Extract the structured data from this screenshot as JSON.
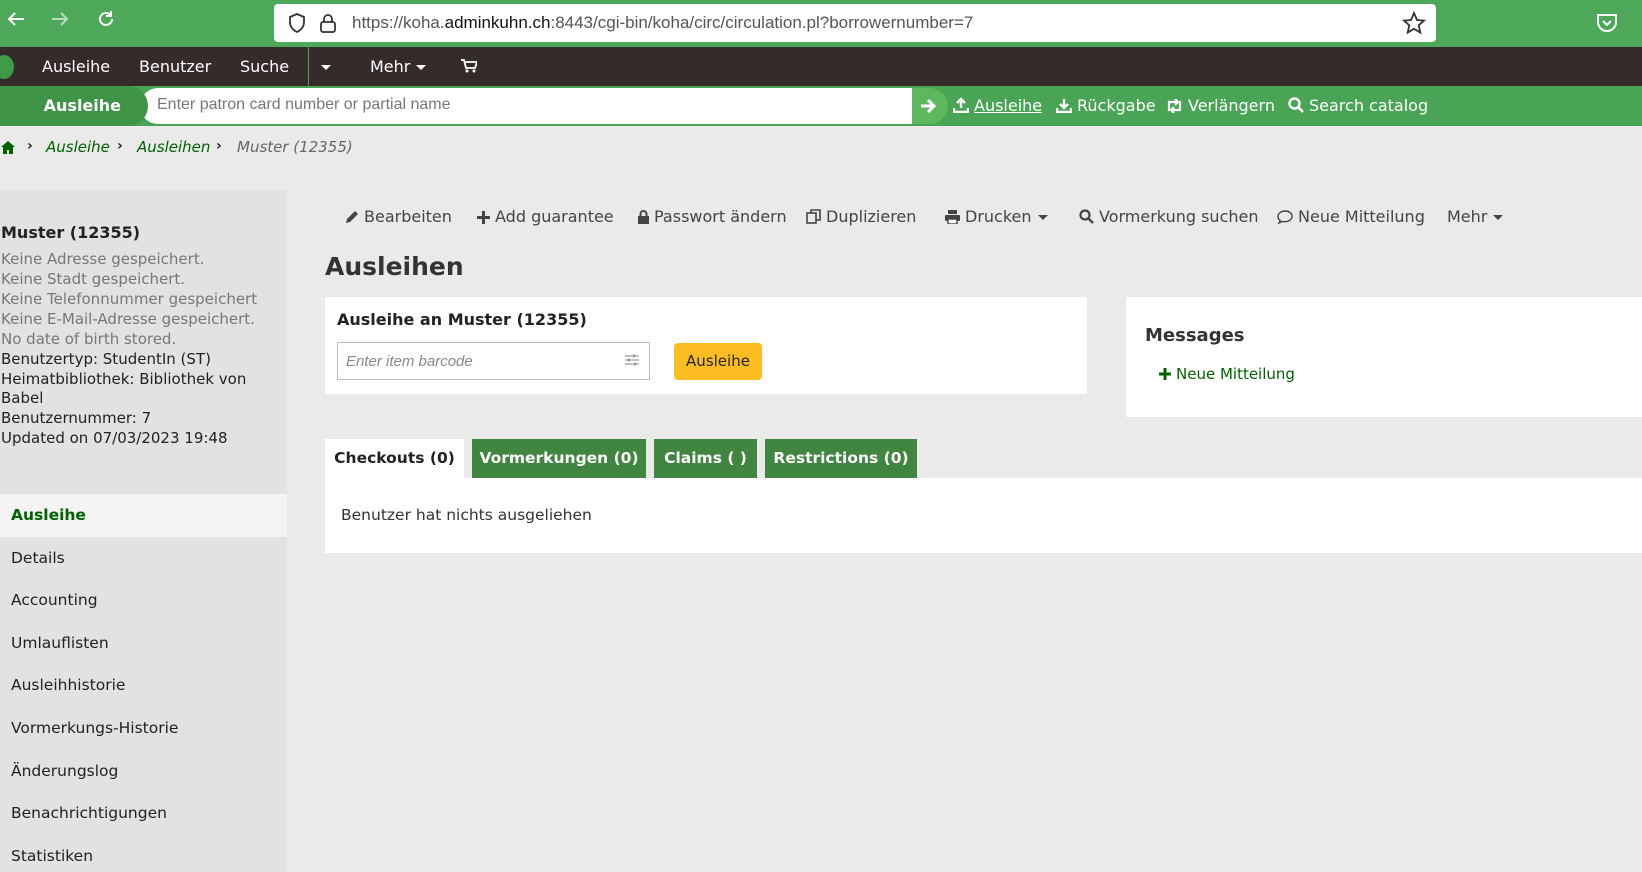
{
  "browser": {
    "url_prefix": "https://koha.",
    "url_domain": "adminkuhn.ch",
    "url_rest": ":8443/cgi-bin/koha/circ/circulation.pl?borrowernumber=7",
    "back_icon": "arrow-left-icon",
    "forward_icon": "arrow-right-icon",
    "reload_icon": "reload-icon"
  },
  "topnav": {
    "items": [
      "Ausleihe",
      "Benutzer",
      "Suche",
      "Mehr"
    ],
    "cart_icon": "cart-icon"
  },
  "circbar": {
    "tab_label": "Ausleihe",
    "search_placeholder": "Enter patron card number or partial name",
    "links": [
      "Ausleihe",
      "Rückgabe",
      "Verlängern",
      "Search catalog"
    ]
  },
  "breadcrumb": {
    "items": [
      "Ausleihe",
      "Ausleihen",
      "Muster (12355)"
    ]
  },
  "patron": {
    "name": "Muster (12355)",
    "lines": [
      "Keine Adresse gespeichert.",
      "Keine Stadt gespeichert.",
      "Keine Telefonnummer gespeichert",
      "Keine E-Mail-Adresse gespeichert.",
      "No date of birth stored."
    ],
    "details": [
      "Benutzertyp: StudentIn (ST)",
      "Heimatbibliothek: Bibliothek von",
      "Babel",
      "Benutzernummer: 7",
      "Updated on 07/03/2023 19:48"
    ]
  },
  "sidebar_menu": [
    "Ausleihe",
    "Details",
    "Accounting",
    "Umlauflisten",
    "Ausleihhistorie",
    "Vormerkungs-Historie",
    "Änderungslog",
    "Benachrichtigungen",
    "Statistiken"
  ],
  "toolbar": [
    "Bearbeiten",
    "Add guarantee",
    "Passwort ändern",
    "Duplizieren",
    "Drucken",
    "Vormerkung suchen",
    "Neue Mitteilung",
    "Mehr"
  ],
  "page_title": "Ausleihen",
  "checkout": {
    "title": "Ausleihe an Muster (12355)",
    "barcode_placeholder": "Enter item barcode",
    "button": "Ausleihe"
  },
  "messages": {
    "title": "Messages",
    "link": "Neue Mitteilung"
  },
  "tabs": [
    "Checkouts (0)",
    "Vormerkungen (0)",
    "Claims ( )",
    "Restrictions (0)"
  ],
  "tab_content": "Benutzer hat nichts ausgeliehen",
  "colors": {
    "browser_green": "#4ea85a",
    "koha_dark": "#362b2b",
    "koha_green": "#4aa456",
    "link_green": "#006100",
    "tab_green": "#408540",
    "button_yellow": "#fcbd22"
  }
}
